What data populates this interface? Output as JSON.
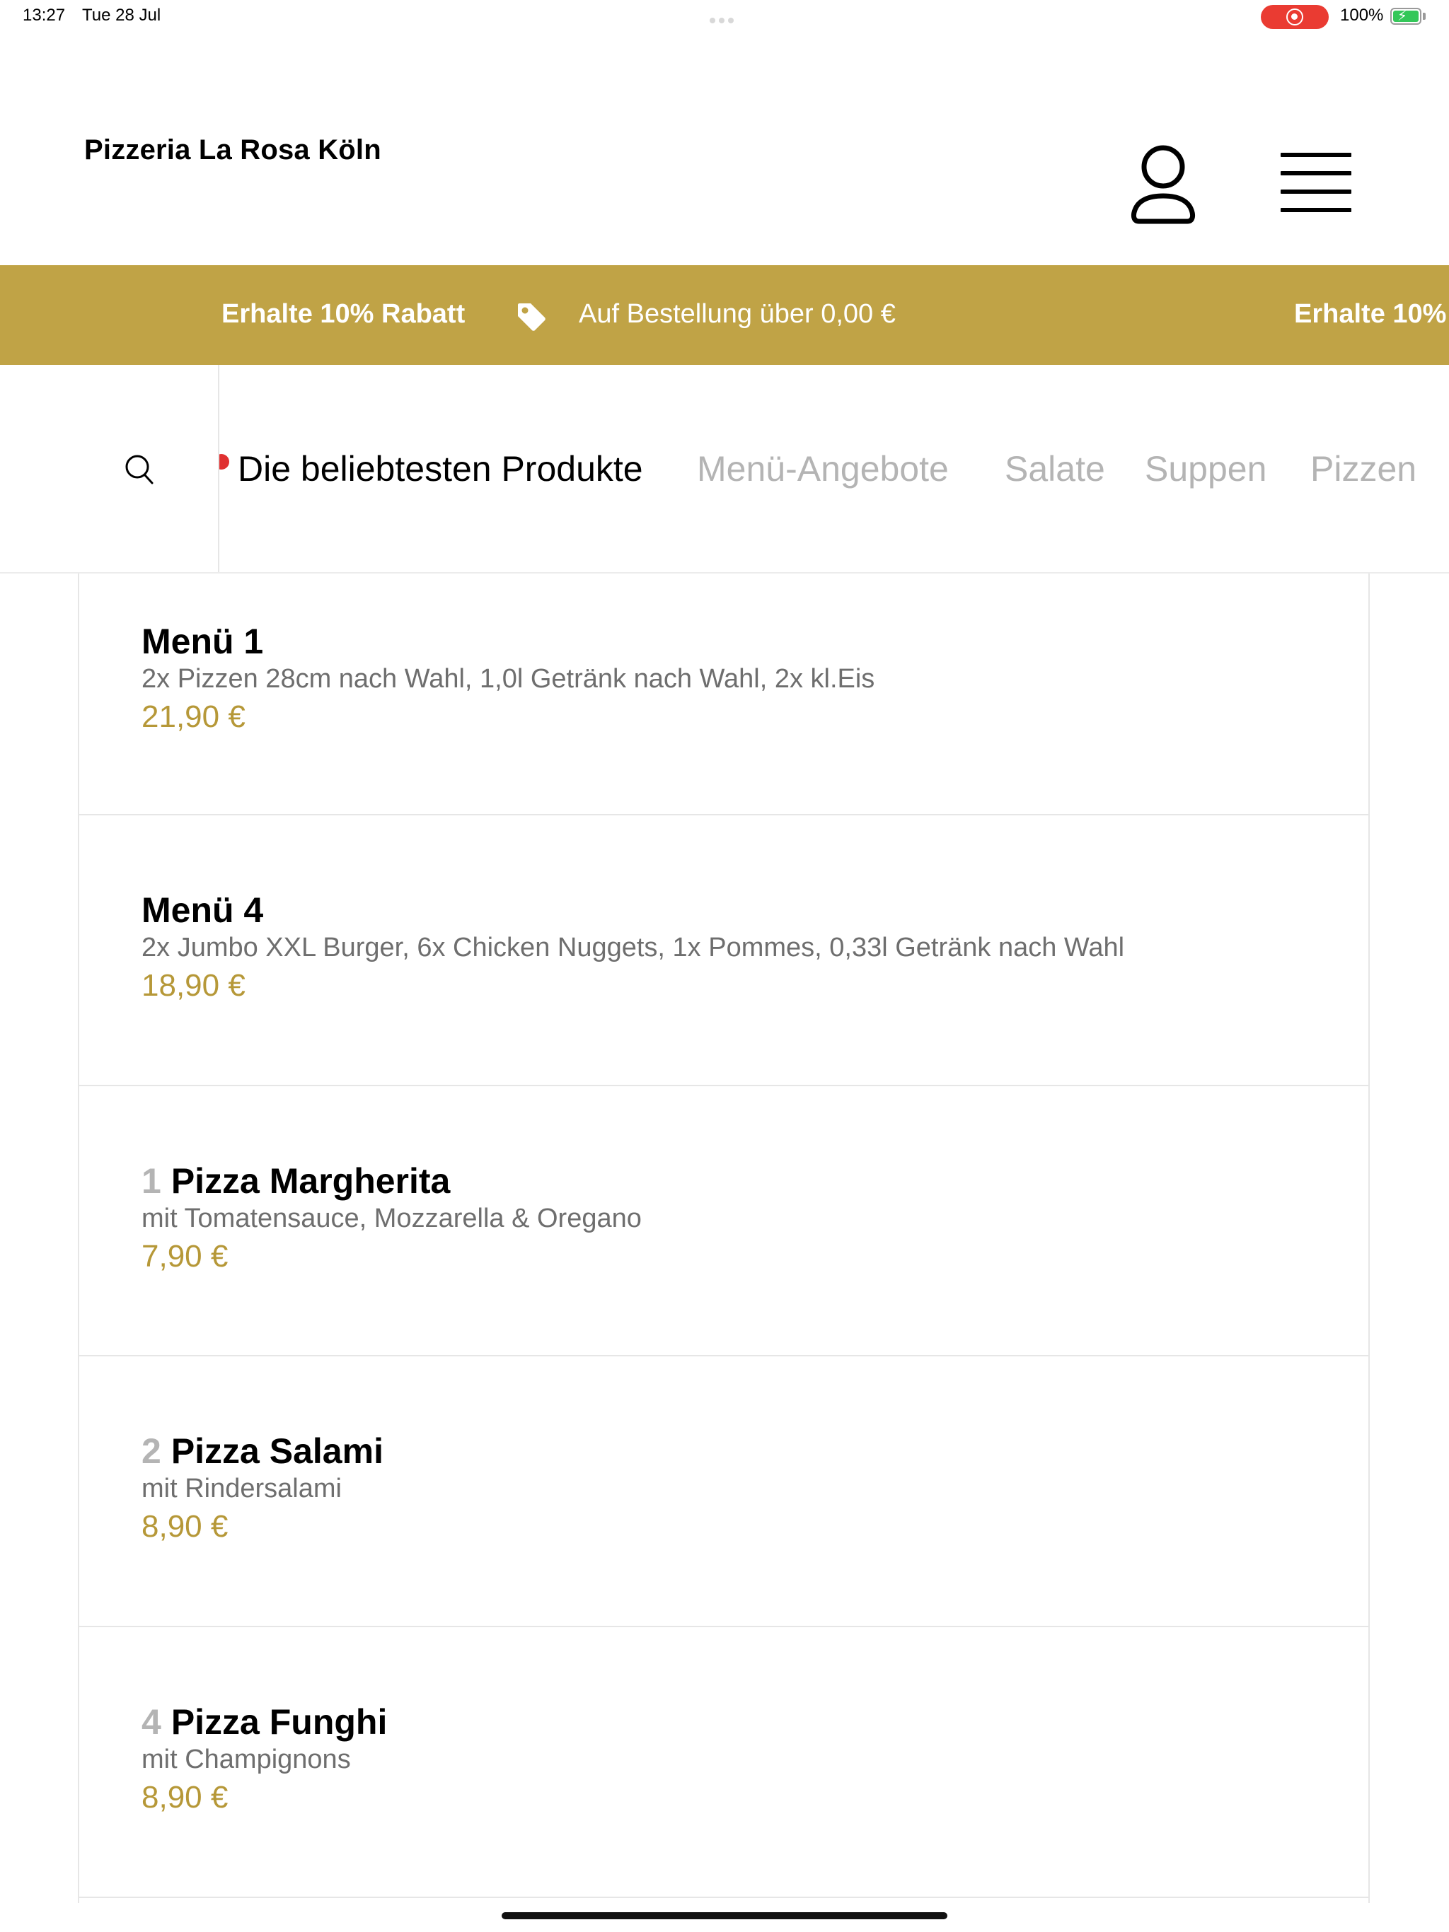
{
  "status_bar": {
    "time": "13:27",
    "date": "Tue 28 Jul",
    "battery": "100%",
    "recording": true
  },
  "header": {
    "brand": "Pizzeria La Rosa Köln",
    "user_icon": "user-icon",
    "menu_icon": "hamburger-menu-icon"
  },
  "promo": {
    "title": "Erhalte 10% Rabatt",
    "icon": "tag-icon",
    "text": "Auf Bestellung über 0,00 €",
    "title_repeat": "Erhalte 10%",
    "background": "#c0a346"
  },
  "categories": {
    "search_icon": "search-icon",
    "items": [
      {
        "label": "Die beliebtesten Produkte",
        "active": true
      },
      {
        "label": "Menü-Angebote",
        "active": false
      },
      {
        "label": "Salate",
        "active": false
      },
      {
        "label": "Suppen",
        "active": false
      },
      {
        "label": "Pizzen",
        "active": false
      }
    ]
  },
  "products": [
    {
      "number": "",
      "name": "Menü 1",
      "description": "2x Pizzen 28cm nach Wahl, 1,0l Getränk nach Wahl, 2x kl.Eis",
      "price": "21,90 €"
    },
    {
      "number": "",
      "name": "Menü 4",
      "description": "2x Jumbo XXL Burger, 6x Chicken Nuggets, 1x Pommes, 0,33l Getränk nach Wahl",
      "price": "18,90 €"
    },
    {
      "number": "1",
      "name": "Pizza Margherita",
      "description": "mit Tomatensauce, Mozzarella & Oregano",
      "price": "7,90 €"
    },
    {
      "number": "2",
      "name": "Pizza Salami",
      "description": "mit Rindersalami",
      "price": "8,90 €"
    },
    {
      "number": "4",
      "name": "Pizza Funghi",
      "description": "mit Champignons",
      "price": "8,90 €"
    }
  ],
  "colors": {
    "accent": "#c0a346",
    "price": "#b69838",
    "inactive_category": "#b4b4b4",
    "description": "#6e6e6e"
  }
}
